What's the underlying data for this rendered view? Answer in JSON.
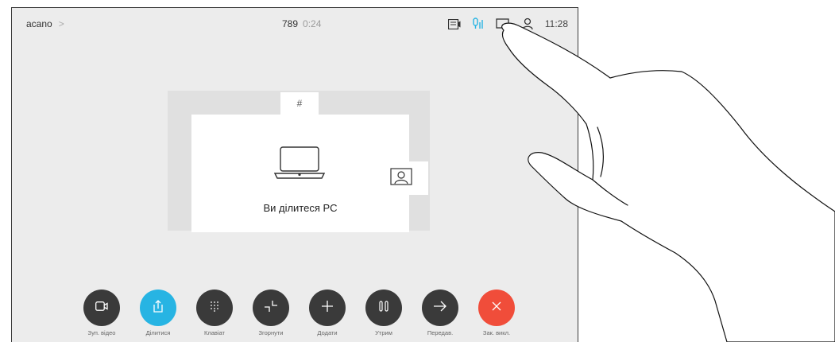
{
  "header": {
    "breadcrumb": "acano",
    "call_number": "789",
    "call_timer": "0:24",
    "clock": "11:28"
  },
  "stage": {
    "hash_label": "#",
    "share_message": "Ви ділитеся PC"
  },
  "controls": [
    {
      "label": "Зуп. відео",
      "icon": "camera-icon",
      "color": "#3a3a3a"
    },
    {
      "label": "Ділитися",
      "icon": "share-icon",
      "color": "#27b4e3"
    },
    {
      "label": "Клавіат",
      "icon": "keypad-icon",
      "color": "#3a3a3a"
    },
    {
      "label": "Згорнути",
      "icon": "minimize-icon",
      "color": "#3a3a3a"
    },
    {
      "label": "Додати",
      "icon": "add-icon",
      "color": "#3a3a3a"
    },
    {
      "label": "Утрим",
      "icon": "hold-icon",
      "color": "#3a3a3a"
    },
    {
      "label": "Передав.",
      "icon": "transfer-icon",
      "color": "#3a3a3a"
    },
    {
      "label": "Зак. викл.",
      "icon": "end-call-icon",
      "color": "#f04d3a"
    }
  ],
  "colors": {
    "accent": "#27b4e3",
    "end_call": "#f04d3a",
    "mic_active": "#27b4e3"
  }
}
